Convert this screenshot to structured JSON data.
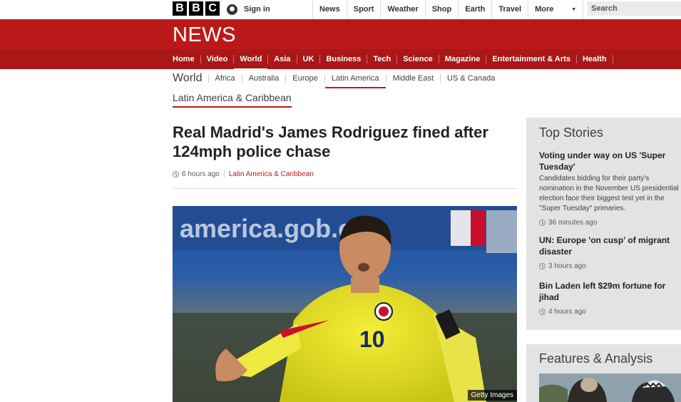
{
  "global": {
    "logo_letters": [
      "B",
      "B",
      "C"
    ],
    "signin": "Sign in",
    "nav": [
      "News",
      "Sport",
      "Weather",
      "Shop",
      "Earth",
      "Travel"
    ],
    "more": "More",
    "search_placeholder": "Search"
  },
  "banner": {
    "brand": "NEWS"
  },
  "main_nav": {
    "items": [
      "Home",
      "Video",
      "World",
      "Asia",
      "UK",
      "Business",
      "Tech",
      "Science",
      "Magazine",
      "Entertainment & Arts",
      "Health"
    ],
    "active": "World"
  },
  "sub_nav": {
    "title": "World",
    "items": [
      "Africa",
      "Australia",
      "Europe",
      "Latin America",
      "Middle East",
      "US & Canada"
    ],
    "active": "Latin America"
  },
  "section": "Latin America & Caribbean",
  "article": {
    "headline": "Real Madrid's James Rodriguez fined after 124mph police chase",
    "time": "6 hours ago",
    "section": "Latin America & Caribbean",
    "image_credit": "Getty Images",
    "image_text": "america.gob.cl",
    "shirt_number": "10"
  },
  "top_stories": {
    "title": "Top Stories",
    "stories": [
      {
        "title": "Voting under way on US 'Super Tuesday'",
        "summary": "Candidates bidding for their party's nomination in the November US presidential election face their biggest test yet in the \"Super Tuesday\" primaries.",
        "time": "36 minutes ago"
      },
      {
        "title": "UN: Europe 'on cusp' of migrant disaster",
        "time": "3 hours ago"
      },
      {
        "title": "Bin Laden left $29m fortune for jihad",
        "time": "4 hours ago"
      }
    ]
  },
  "features": {
    "title": "Features & Analysis"
  },
  "colors": {
    "bbc_red": "#bb1919",
    "nav_red": "#a91717",
    "panel_grey": "#e3e3e3"
  },
  "icons": [
    "signin-icon",
    "chevron-down-icon",
    "clock-icon"
  ]
}
